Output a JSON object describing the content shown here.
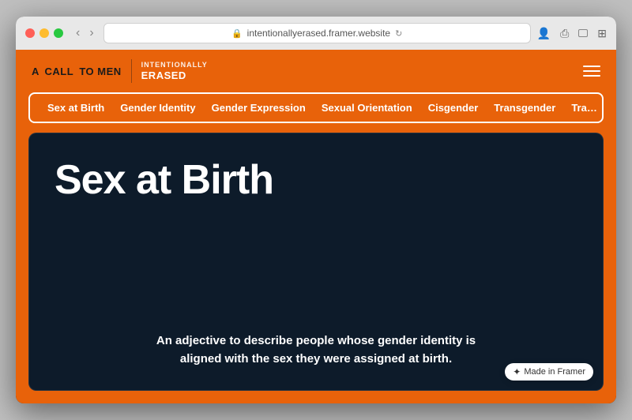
{
  "browser": {
    "url": "intentionallyerased.framer.website",
    "tab_title": "Intentionally Erased"
  },
  "site": {
    "logo_a": "A",
    "logo_call": "CALL",
    "logo_to": "TO",
    "logo_men": "MEN",
    "logo_intentionally": "INTENTIONALLY",
    "logo_erased": "ERASED",
    "menu_icon": "≡"
  },
  "nav": {
    "items": [
      {
        "label": "Sex at Birth",
        "active": true
      },
      {
        "label": "Gender Identity",
        "active": false
      },
      {
        "label": "Gender Expression",
        "active": false
      },
      {
        "label": "Sexual Orientation",
        "active": false
      },
      {
        "label": "Cisgender",
        "active": false
      },
      {
        "label": "Transgender",
        "active": false
      },
      {
        "label": "Tra…",
        "active": false
      }
    ]
  },
  "card": {
    "title": "Sex at Birth",
    "description": "An adjective to describe people whose gender identity is\naligned with the sex they were assigned at birth."
  },
  "framer": {
    "badge": "Made in Framer",
    "icon": "🖼"
  }
}
